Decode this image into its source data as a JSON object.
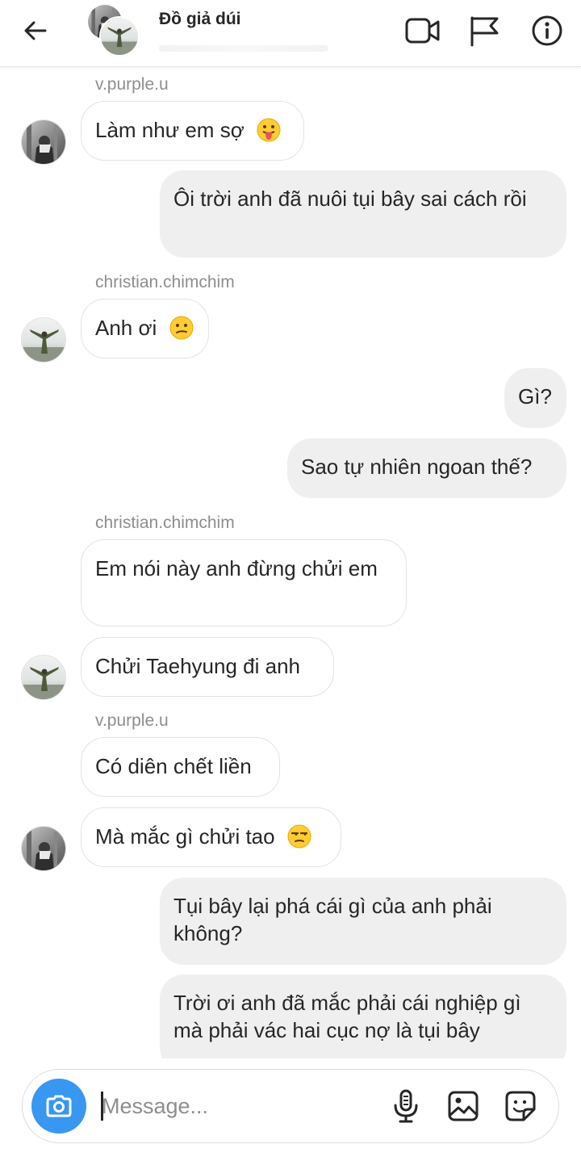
{
  "header": {
    "title": "Đồ giả dúi",
    "icons": [
      "back-arrow-icon",
      "video-call-icon",
      "flag-icon",
      "info-icon"
    ]
  },
  "messages": [
    {
      "sender_label": "v.purple.u",
      "text": "Làm như em sợ",
      "emoji": "tongue-out-emoji",
      "side": "incoming"
    },
    {
      "text": "Ôi trời anh đã nuôi tụi bây sai cách rồi",
      "side": "outgoing"
    },
    {
      "sender_label": "christian.chimchim",
      "text": "Anh ơi",
      "emoji": "confused-face-emoji",
      "side": "incoming"
    },
    {
      "text": "Gì?",
      "side": "outgoing"
    },
    {
      "text": "Sao tự nhiên ngoan thế?",
      "side": "outgoing"
    },
    {
      "sender_label": "christian.chimchim",
      "text": "Em nói này anh đừng chửi em",
      "side": "incoming"
    },
    {
      "text": "Chửi Taehyung đi anh",
      "side": "incoming"
    },
    {
      "sender_label": "v.purple.u",
      "text": "Có diên chết liền",
      "side": "incoming"
    },
    {
      "text": "Mà mắc gì chửi tao",
      "emoji": "unamused-face-emoji",
      "side": "incoming"
    },
    {
      "text": "Tụi bây lại phá cái gì của anh phải không?",
      "side": "outgoing"
    },
    {
      "text": "Trời ơi anh đã mắc phải cái nghiệp gì mà phải vác hai cục nợ là tụi bây",
      "side": "outgoing"
    }
  ],
  "composer": {
    "placeholder": "Message...",
    "icons": [
      "camera-icon",
      "microphone-icon",
      "gallery-icon",
      "sticker-icon"
    ],
    "accent_color": "#3897f0"
  },
  "colors": {
    "outgoing_bubble": "#efefef",
    "incoming_bubble_border": "#e3e3e3",
    "username": "#8e8e8e"
  }
}
